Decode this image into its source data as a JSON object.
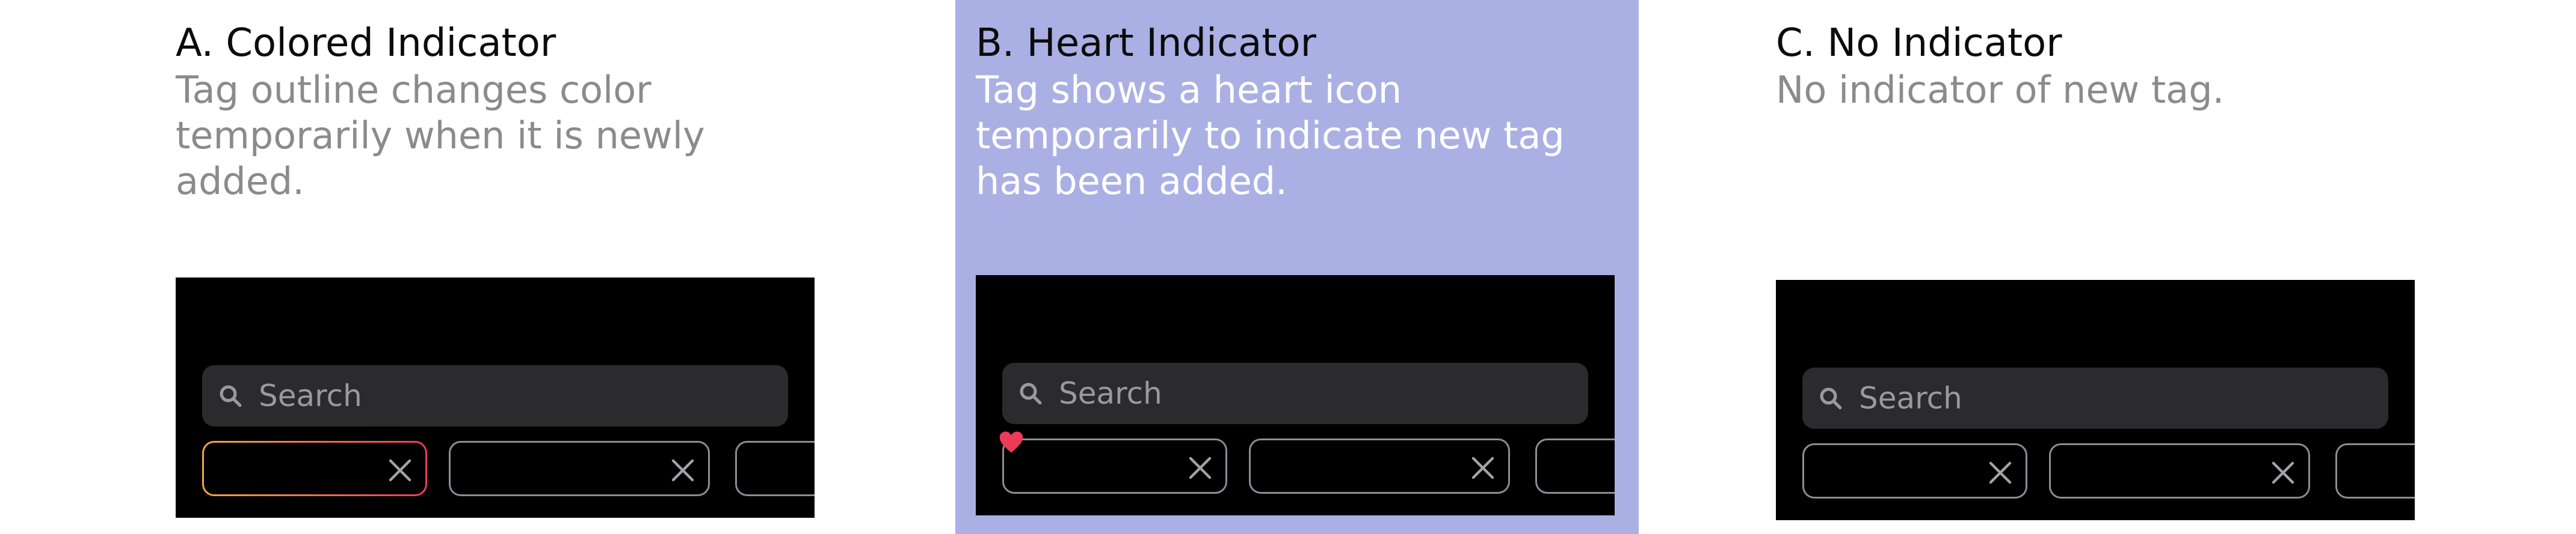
{
  "options": [
    {
      "title": "A. Colored Indicator",
      "description": "Tag outline changes color temporarily when it is newly added.",
      "search_placeholder": "Search"
    },
    {
      "title": "B. Heart Indicator",
      "description": "Tag shows a heart icon temporarily to indicate new tag has been added.",
      "search_placeholder": "Search"
    },
    {
      "title": "C. No Indicator",
      "description": "No indicator of new tag.",
      "search_placeholder": "Search"
    }
  ],
  "colors": {
    "selected_background": "#aab0e4",
    "indicator_gradient_start": "#f4a641",
    "indicator_gradient_end": "#ee3a59",
    "heart": "#ee3a59"
  },
  "icons": [
    "search-icon",
    "close-icon",
    "heart-icon"
  ]
}
